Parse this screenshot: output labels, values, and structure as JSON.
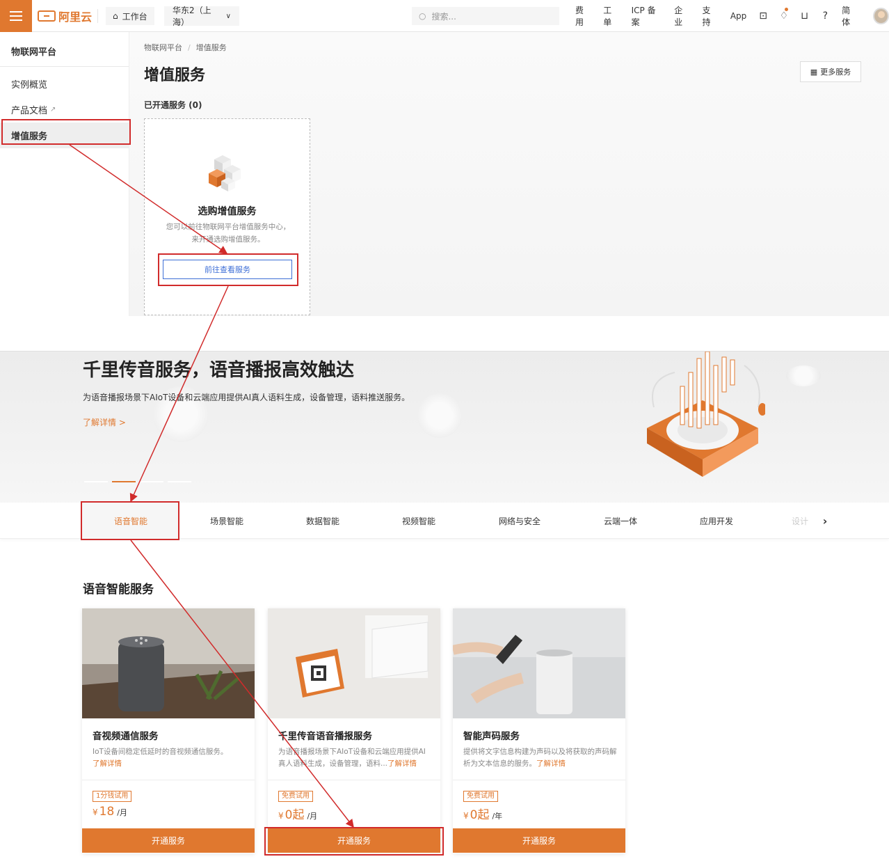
{
  "topbar": {
    "logo_text": "阿里云",
    "workbench": "工作台",
    "region": "华东2（上海）",
    "search_placeholder": "搜索...",
    "links": [
      "费用",
      "工单",
      "ICP 备案",
      "企业",
      "支持",
      "App"
    ],
    "lang": "简体",
    "accent": "#e0782f"
  },
  "sidebar": {
    "title": "物联网平台",
    "items": [
      {
        "label": "实例概览"
      },
      {
        "label": "产品文档",
        "icon": "external-link-icon"
      },
      {
        "label": "增值服务",
        "active": true
      }
    ]
  },
  "main": {
    "breadcrumb": [
      "物联网平台",
      "增值服务"
    ],
    "title": "增值服务",
    "more_services": "更多服务",
    "opened_label": "已开通服务 (0)",
    "empty": {
      "title": "选购增值服务",
      "desc": "您可以前往物联网平台增值服务中心，来开通选购增值服务。",
      "button": "前往查看服务"
    }
  },
  "banner": {
    "title": "千里传音服务，语音播报高效触达",
    "desc": "为语音播报场景下AIoT设备和云端应用提供AI真人语料生成，设备管理，语料推送服务。",
    "link": "了解详情 >",
    "active_slide": 2,
    "slide_count": 4
  },
  "tabs": [
    "语音智能",
    "场景智能",
    "数据智能",
    "视频智能",
    "网络与安全",
    "云端一体",
    "应用开发",
    "设计"
  ],
  "section_title": "语音智能服务",
  "cards": [
    {
      "name": "音视频通信服务",
      "desc": "IoT设备间稳定低延时的音视频通信服务。",
      "more": "了解详情",
      "badge": "1分钱试用",
      "currency": "¥",
      "price": "18",
      "unit": "/月",
      "button": "开通服务"
    },
    {
      "name": "千里传音语音播报服务",
      "desc": "为语音播报场景下AIoT设备和云端应用提供AI真人语料生成，设备管理，语料...",
      "more": "了解详情",
      "badge": "免费试用",
      "currency": "¥",
      "price": "0起",
      "unit": "/月",
      "button": "开通服务"
    },
    {
      "name": "智能声码服务",
      "desc": "提供将文字信息构建为声码以及将获取的声码解析为文本信息的服务。",
      "more": "了解详情",
      "badge": "免费试用",
      "currency": "¥",
      "price": "0起",
      "unit": "/年",
      "button": "开通服务"
    }
  ]
}
